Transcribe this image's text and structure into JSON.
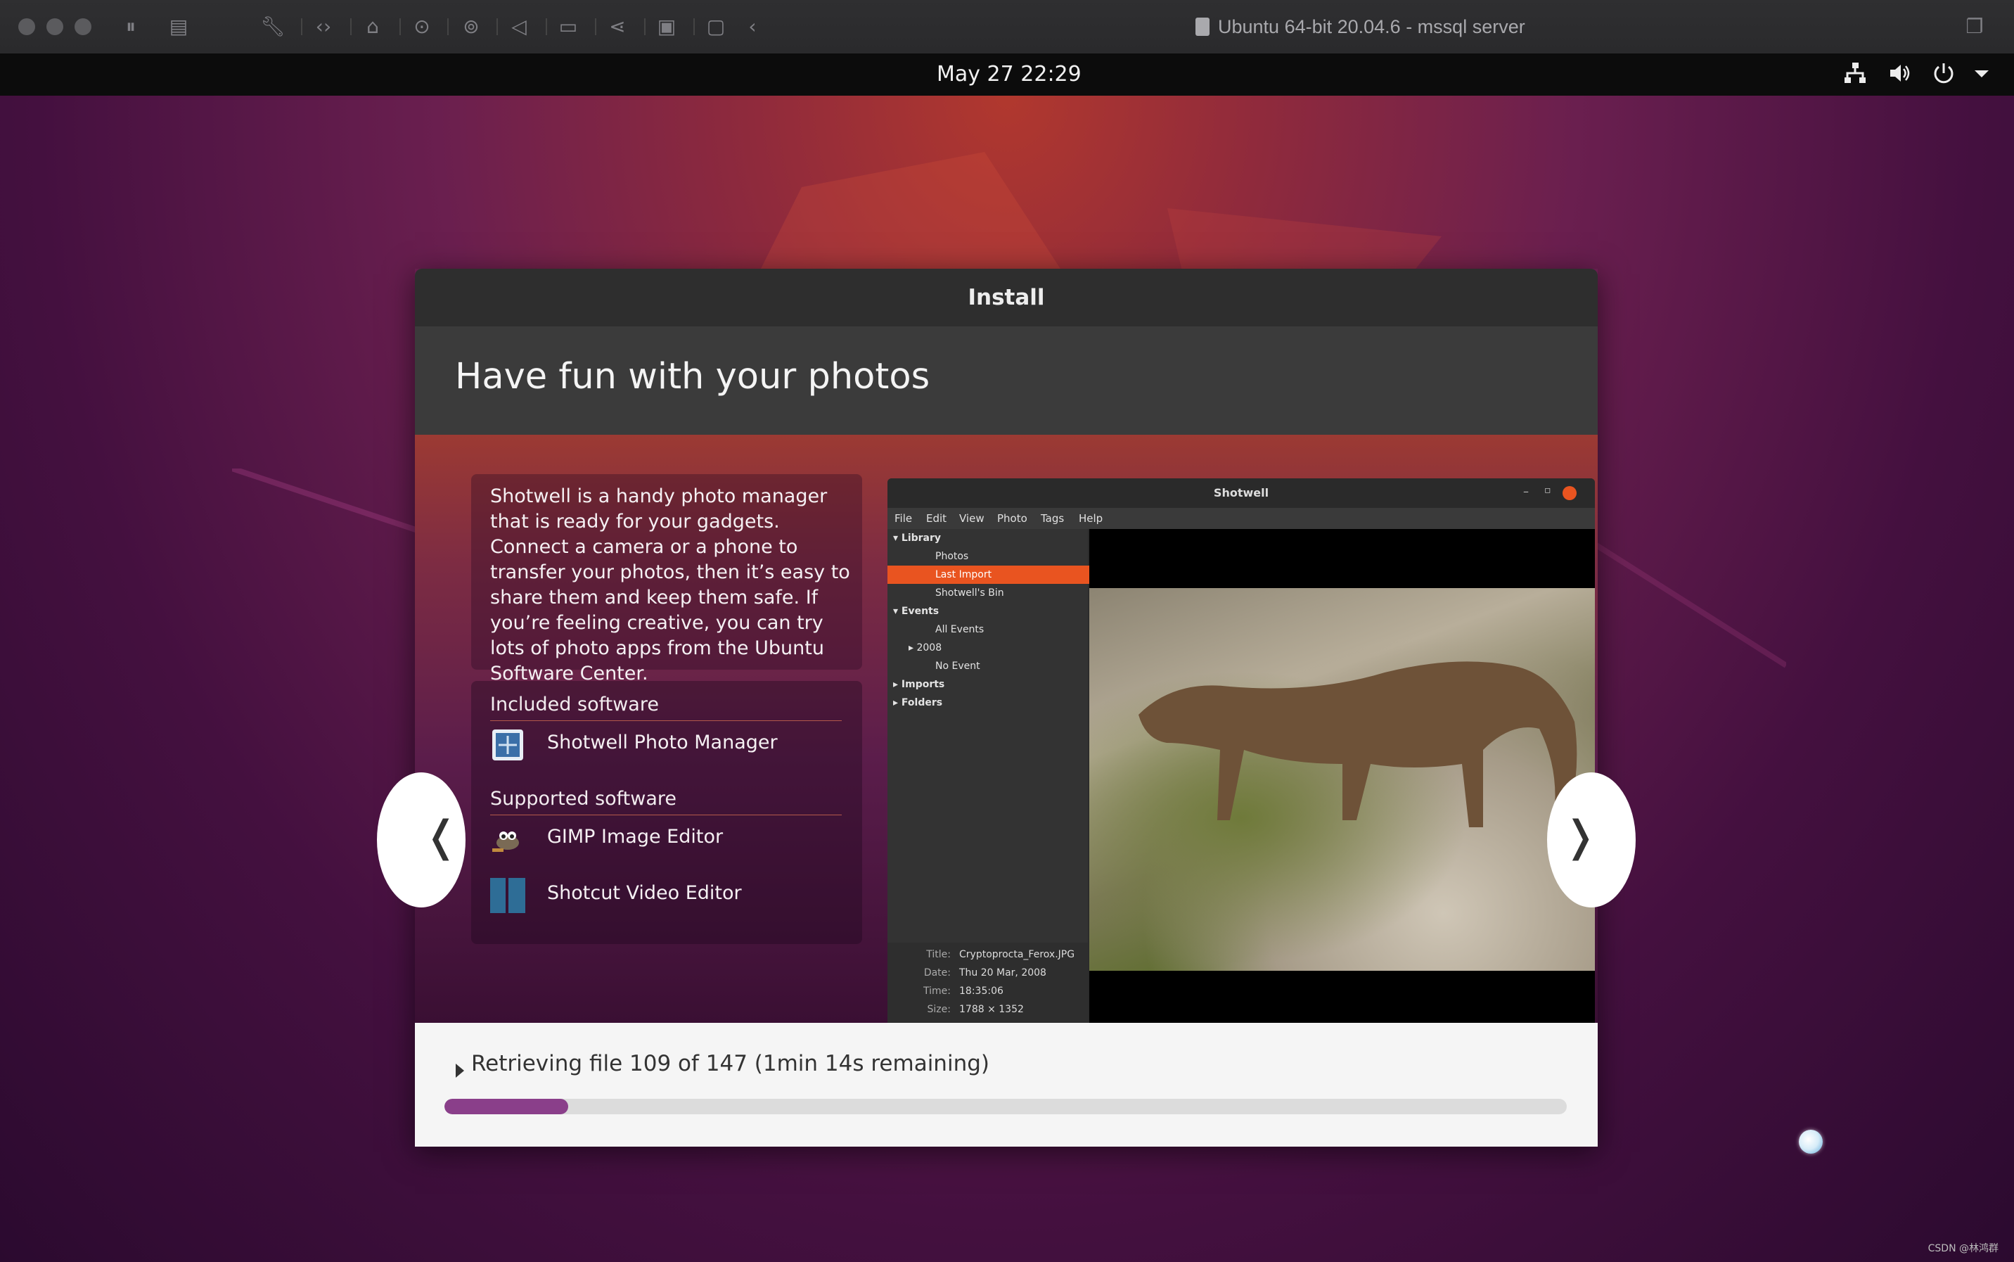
{
  "host_window": {
    "title": "Ubuntu 64-bit 20.04.6 - mssql server",
    "toolbar_icons": [
      "pause-icon",
      "snapshot-icon",
      "settings-wrench-icon",
      "code-icon",
      "hard-disk-icon",
      "cdrom-icon",
      "usb-icon",
      "sound-icon",
      "camera-icon",
      "share-icon",
      "save-icon",
      "folder-icon",
      "back-arrow-icon"
    ]
  },
  "topbar": {
    "clock": "May 27  22:29",
    "icons": [
      "network-icon",
      "volume-icon",
      "power-icon",
      "menu-caret-icon"
    ]
  },
  "dialog": {
    "title": "Install",
    "slide_heading": "Have fun with your photos",
    "description": "Shotwell is a handy photo manager that is ready for your gadgets. Connect a camera or a phone to transfer your photos, then it’s easy to share them and keep them safe. If you’re feeling creative, you can try lots of photo apps from the Ubuntu Software Center.",
    "included_label": "Included software",
    "included": [
      {
        "name": "Shotwell Photo Manager",
        "icon": "shotwell-icon"
      }
    ],
    "supported_label": "Supported software",
    "supported": [
      {
        "name": "GIMP Image Editor",
        "icon": "gimp-icon"
      },
      {
        "name": "Shotcut Video Editor",
        "icon": "shotcut-icon"
      }
    ],
    "prev_arrow": "❬",
    "next_arrow": "❭",
    "progress_text": "Retrieving file 109 of 147 (1min 14s remaining)",
    "progress_fraction": 0.11
  },
  "screenshot": {
    "title": "Shotwell",
    "menu": [
      "File",
      "Edit",
      "View",
      "Photo",
      "Tags",
      "Help"
    ],
    "sidebar": [
      {
        "label": "▾ Library"
      },
      {
        "label": "Photos"
      },
      {
        "label": "Last Import"
      },
      {
        "label": "Shotwell's Bin"
      },
      {
        "label": "▾ Events"
      },
      {
        "label": "All Events"
      },
      {
        "label": "▸ 2008"
      },
      {
        "label": "No Event"
      },
      {
        "label": "▸ Imports"
      },
      {
        "label": "▸ Folders"
      }
    ],
    "info": [
      {
        "key": "Title:",
        "value": "Cryptoprocta_Ferox.JPG"
      },
      {
        "key": "Date:",
        "value": "Thu 20 Mar, 2008"
      },
      {
        "key": "Time:",
        "value": "18:35:06"
      },
      {
        "key": "Size:",
        "value": "1788 × 1352"
      }
    ]
  },
  "watermark": "CSDN @林鸿群"
}
